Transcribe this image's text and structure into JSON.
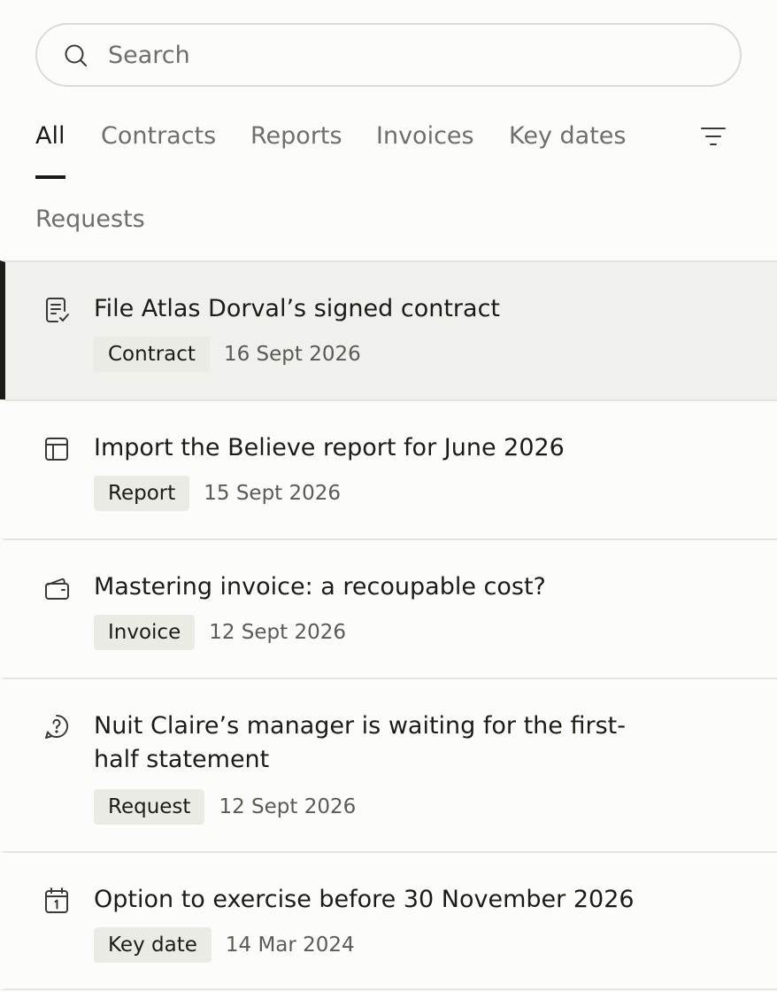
{
  "search": {
    "placeholder": "Search",
    "value": ""
  },
  "tabs": [
    {
      "label": "All",
      "active": true
    },
    {
      "label": "Contracts",
      "active": false
    },
    {
      "label": "Reports",
      "active": false
    },
    {
      "label": "Invoices",
      "active": false
    },
    {
      "label": "Key dates",
      "active": false
    },
    {
      "label": "Requests",
      "active": false
    }
  ],
  "items": [
    {
      "icon": "contract-check-icon",
      "title": "File Atlas Dorval’s signed contract",
      "badge": "Contract",
      "date": "16 Sept 2026",
      "selected": true
    },
    {
      "icon": "report-table-icon",
      "title": "Import the Believe report for June 2026",
      "badge": "Report",
      "date": "15 Sept 2026",
      "selected": false
    },
    {
      "icon": "wallet-icon",
      "title": "Mastering invoice: a recoupable cost?",
      "badge": "Invoice",
      "date": "12 Sept 2026",
      "selected": false
    },
    {
      "icon": "chat-question-icon",
      "title": "Nuit Claire’s manager is waiting for the first-half statement",
      "badge": "Request",
      "date": "12 Sept 2026",
      "selected": false
    },
    {
      "icon": "calendar-icon",
      "title": "Option to exercise before 30 November 2026",
      "badge": "Key date",
      "date": "14 Mar 2024",
      "selected": false
    }
  ],
  "icons": {
    "search": "search-icon",
    "filter": "filter-icon"
  },
  "colors": {
    "text": "#1c1c17",
    "muted": "#6f6f69",
    "selected_bg": "#f0f0ec",
    "badge_bg": "#ebebe6",
    "accent": "#1c1c17"
  }
}
